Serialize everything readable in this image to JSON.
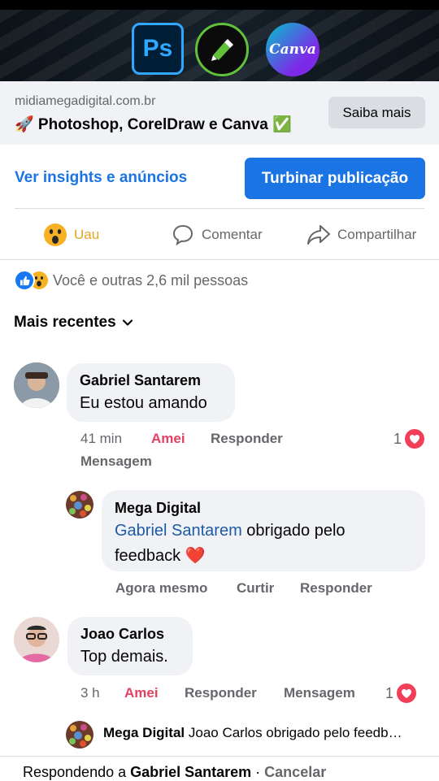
{
  "banner": {
    "apps": [
      {
        "name": "Photoshop",
        "icon_text": "Ps"
      },
      {
        "name": "CorelDraw",
        "icon_text": ""
      },
      {
        "name": "Canva",
        "icon_text": "Canva"
      }
    ]
  },
  "link_preview": {
    "domain": "midiamegadigital.com.br",
    "title": "🚀 Photoshop, CorelDraw e Canva ✅",
    "button_label": "Saiba mais"
  },
  "promo": {
    "insights_label": "Ver insights e anúncios",
    "boost_label": "Turbinar publicação"
  },
  "actions": {
    "reaction_label": "Uau",
    "comment_label": "Comentar",
    "share_label": "Compartilhar"
  },
  "reactions_summary": {
    "text": "Você e outras 2,6 mil pessoas",
    "icons": [
      "like-icon",
      "wow-icon"
    ]
  },
  "sort": {
    "label": "Mais recentes"
  },
  "comments": [
    {
      "author": "Gabriel Santarem",
      "text": "Eu estou amando",
      "time": "41 min",
      "reaction": "Amei",
      "reply_label": "Responder",
      "message_label": "Mensagem",
      "like_count": "1",
      "reply": {
        "author": "Mega Digital",
        "mention": "Gabriel Santarem",
        "text_line1": " obrigado pelo",
        "text_line2": "feedback ❤️",
        "time": "Agora mesmo",
        "like_label": "Curtir",
        "reply_label": "Responder"
      }
    },
    {
      "author": "Joao Carlos",
      "text": "Top demais.",
      "time": "3 h",
      "reaction": "Amei",
      "reply_label": "Responder",
      "message_label": "Mensagem",
      "like_count": "1",
      "reply_preview": {
        "author": "Mega Digital",
        "text": "Joao Carlos obrigado pelo feedb…"
      }
    }
  ],
  "composer": {
    "prefix": "Respondendo a ",
    "target": "Gabriel Santarem",
    "separator": " · ",
    "cancel_label": "Cancelar"
  },
  "colors": {
    "accent_blue": "#1b74e4",
    "love_red": "#e4405f",
    "wow_yellow": "#e5a524",
    "bubble_bg": "#f0f2f5"
  }
}
